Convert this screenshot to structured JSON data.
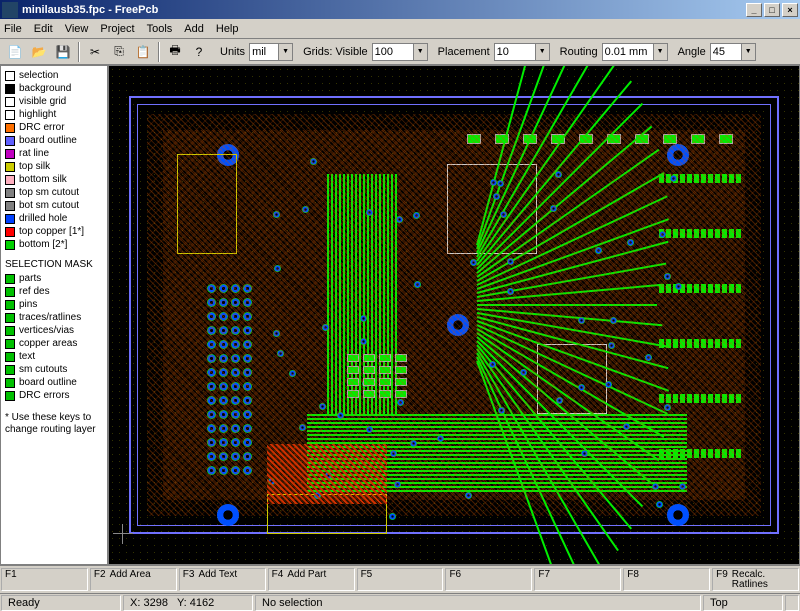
{
  "title": "minilausb35.fpc - FreePcb",
  "window_buttons": {
    "min": "_",
    "max": "□",
    "close": "×"
  },
  "menu": [
    "File",
    "Edit",
    "View",
    "Project",
    "Tools",
    "Add",
    "Help"
  ],
  "toolbar": {
    "icons": [
      "new",
      "open",
      "save",
      "cut",
      "copy",
      "paste",
      "print",
      "help"
    ],
    "units_label": "Units",
    "units_value": "mil",
    "grids_label": "Grids: Visible",
    "grids_value": "100",
    "placement_label": "Placement",
    "placement_value": "10",
    "routing_label": "Routing",
    "routing_value": "0.01 mm",
    "angle_label": "Angle",
    "angle_value": "45"
  },
  "legend": [
    {
      "c": "#ffffff",
      "t": "selection"
    },
    {
      "c": "#000000",
      "t": "background"
    },
    {
      "c": "#ffffff",
      "t": "visible grid"
    },
    {
      "c": "#ffffff",
      "t": "highlight"
    },
    {
      "c": "#ff7000",
      "t": "DRC error"
    },
    {
      "c": "#6060ff",
      "t": "board outline"
    },
    {
      "c": "#c000c0",
      "t": "rat line"
    },
    {
      "c": "#cccc00",
      "t": "top silk"
    },
    {
      "c": "#ffb0c0",
      "t": "bottom silk"
    },
    {
      "c": "#808080",
      "t": "top sm cutout"
    },
    {
      "c": "#808080",
      "t": "bot sm cutout"
    },
    {
      "c": "#0040ff",
      "t": "drilled hole"
    },
    {
      "c": "#ff0000",
      "t": "top copper  [1*]"
    },
    {
      "c": "#00d000",
      "t": "bottom        [2*]"
    }
  ],
  "mask_title": "SELECTION MASK",
  "mask": [
    "parts",
    "ref des",
    "pins",
    "traces/ratlines",
    "vertices/vias",
    "copper areas",
    "text",
    "sm cutouts",
    "board outline",
    "DRC errors"
  ],
  "note": "* Use these keys to change routing layer",
  "fnkeys": [
    {
      "k": "F1",
      "l": ""
    },
    {
      "k": "F2",
      "l": "Add Area"
    },
    {
      "k": "F3",
      "l": "Add Text"
    },
    {
      "k": "F4",
      "l": "Add Part"
    },
    {
      "k": "F5",
      "l": ""
    },
    {
      "k": "F6",
      "l": ""
    },
    {
      "k": "F7",
      "l": ""
    },
    {
      "k": "F8",
      "l": ""
    },
    {
      "k": "F9",
      "l": "Recalc. Ratlines"
    }
  ],
  "status": {
    "ready": "Ready",
    "x_label": "X:",
    "x": "3298",
    "y_label": "Y:",
    "y": "4162",
    "sel": "No selection",
    "layer": "Top"
  }
}
